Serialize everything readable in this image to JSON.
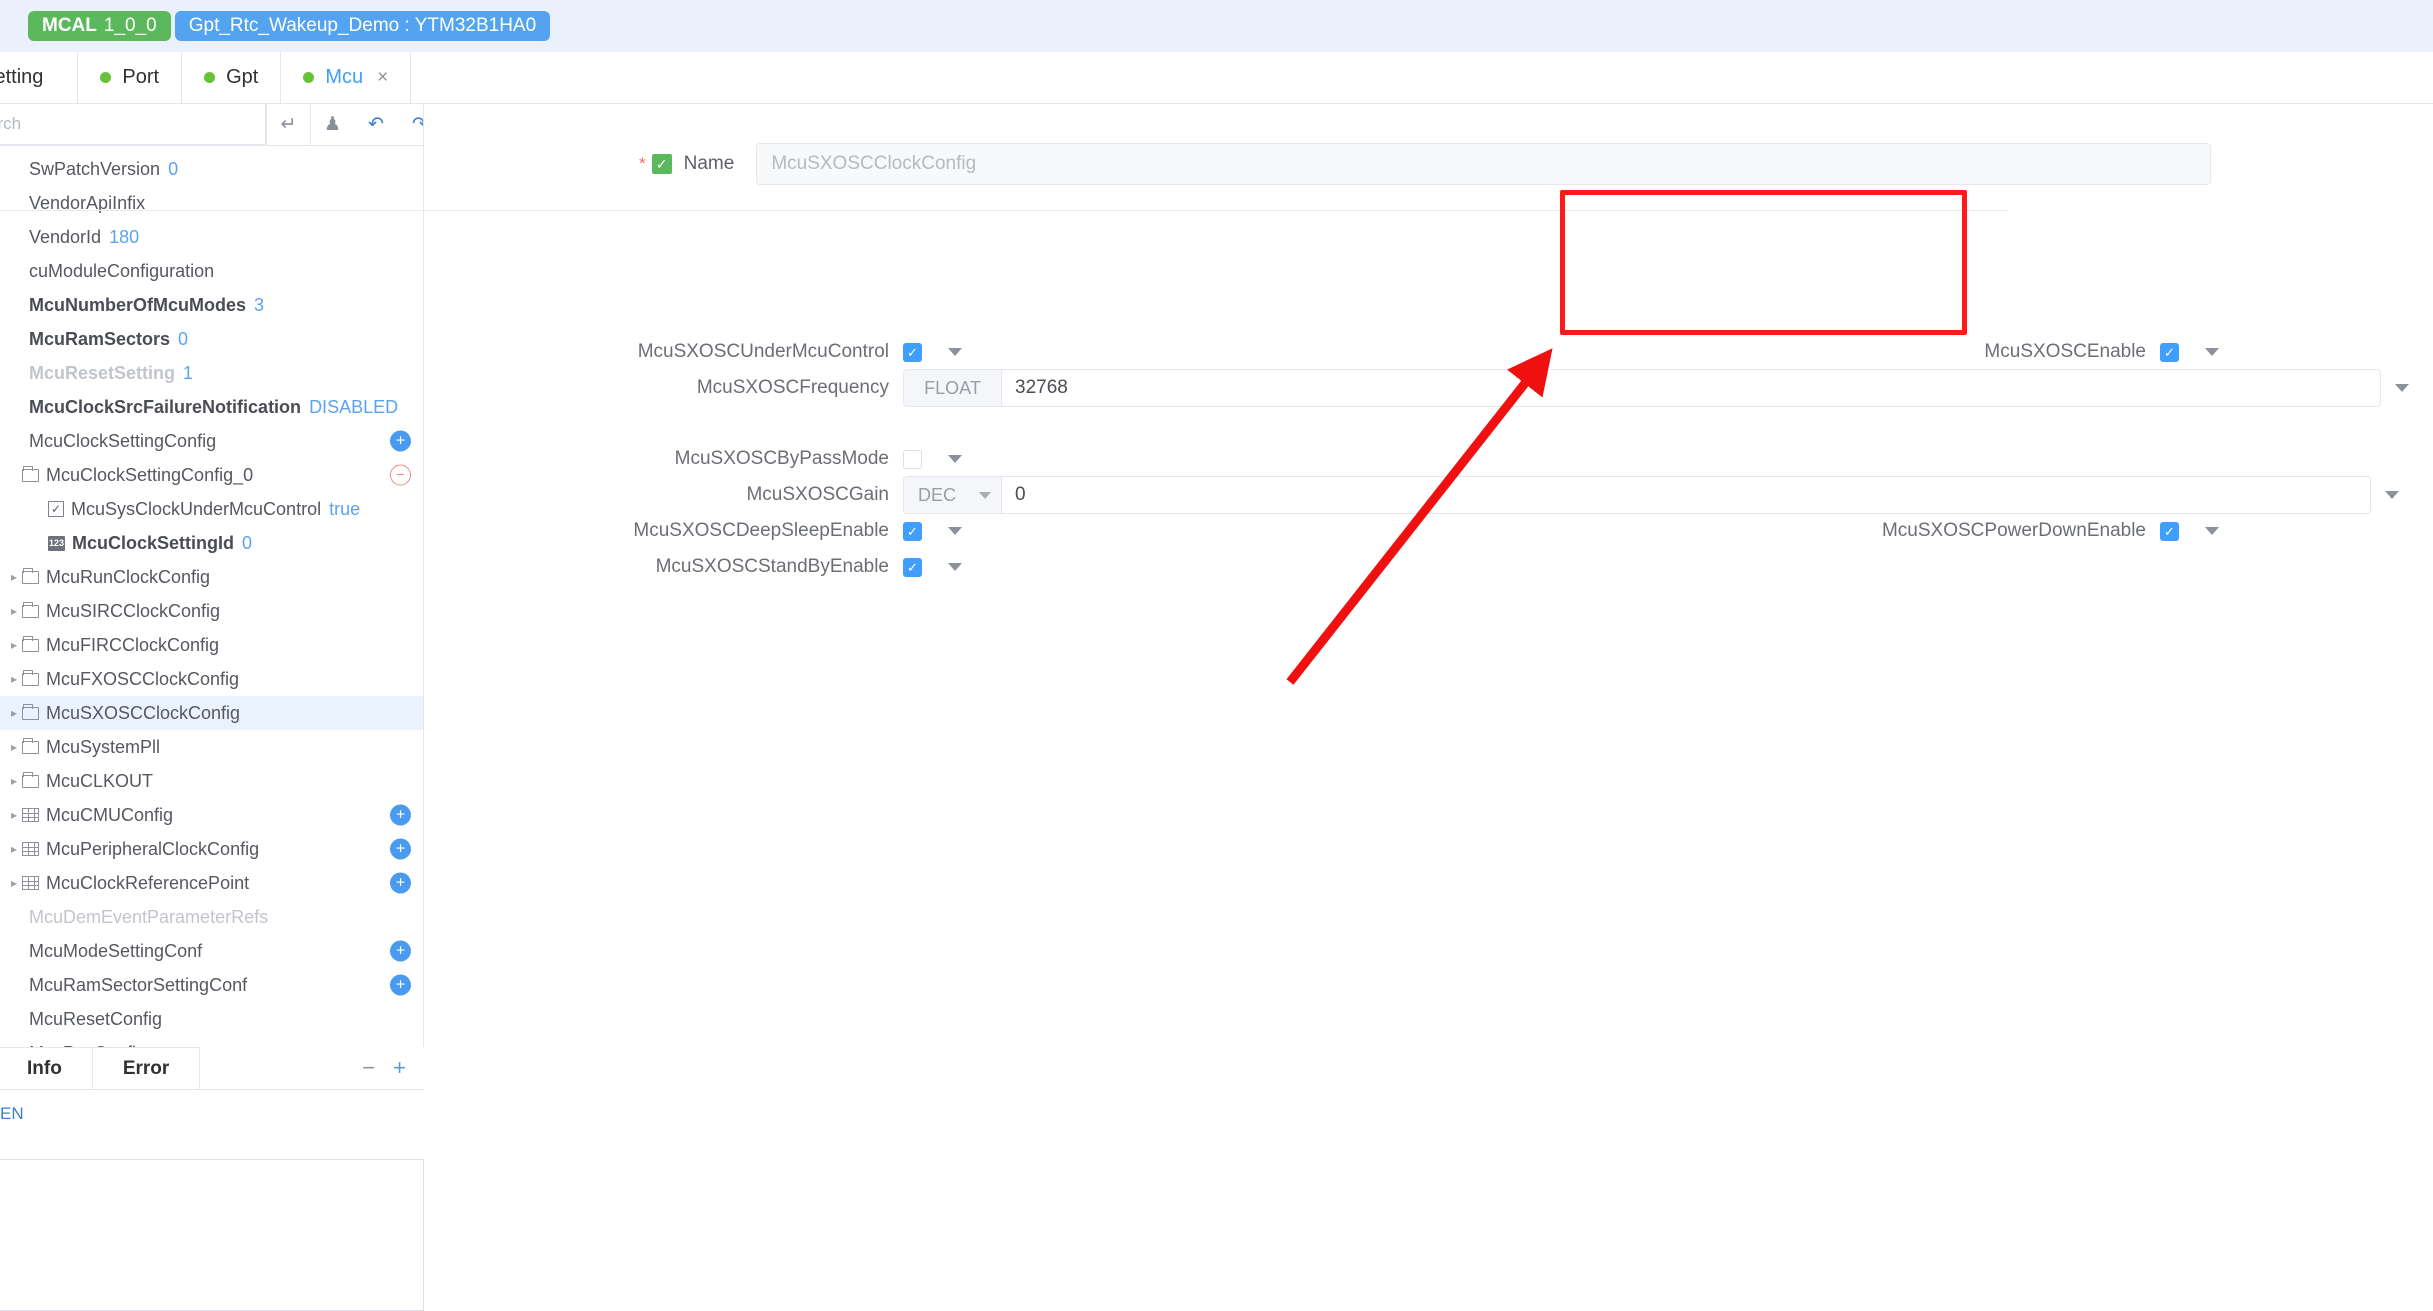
{
  "topbar": {
    "mcal_badge": {
      "name": "MCAL",
      "version": "1_0_0"
    },
    "project_badge": "Gpt_Rtc_Wakeup_Demo : YTM32B1HA0"
  },
  "tabs": [
    {
      "label": "t Setting",
      "dot": false,
      "active": false,
      "closable": false
    },
    {
      "label": "Port",
      "dot": true,
      "active": false,
      "closable": false
    },
    {
      "label": "Gpt",
      "dot": true,
      "active": false,
      "closable": false
    },
    {
      "label": "Mcu",
      "dot": true,
      "active": true,
      "closable": true,
      "close_glyph": "×"
    }
  ],
  "sidebar": {
    "search_placeholder": "arch",
    "toolbar_icons": [
      "undo-arrow-icon",
      "robot-icon",
      "undo-icon",
      "redo-icon"
    ],
    "tree": [
      {
        "label": "SwPatchVersion",
        "value": "0",
        "icon": "none",
        "indent": 0,
        "arrow": false,
        "bold": false,
        "muted": false
      },
      {
        "label": "VendorApiInfix",
        "value": "",
        "icon": "none",
        "indent": 0,
        "arrow": false,
        "bold": false,
        "muted": false
      },
      {
        "label": "VendorId",
        "value": "180",
        "icon": "none",
        "indent": 0,
        "arrow": false,
        "bold": false,
        "muted": false
      },
      {
        "label": "cuModuleConfiguration",
        "value": "",
        "icon": "none",
        "indent": 0,
        "arrow": false,
        "bold": false,
        "muted": false
      },
      {
        "label": "McuNumberOfMcuModes",
        "value": "3",
        "icon": "none",
        "indent": 0,
        "arrow": false,
        "bold": true,
        "muted": false
      },
      {
        "label": "McuRamSectors",
        "value": "0",
        "icon": "none",
        "indent": 0,
        "arrow": false,
        "bold": true,
        "muted": false
      },
      {
        "label": "McuResetSetting",
        "value": "1",
        "icon": "none",
        "indent": 0,
        "arrow": false,
        "bold": true,
        "muted": true
      },
      {
        "label": "McuClockSrcFailureNotification",
        "value": "DISABLED",
        "icon": "none",
        "indent": 0,
        "arrow": false,
        "bold": true,
        "muted": false
      },
      {
        "label": "McuClockSettingConfig",
        "value": "",
        "icon": "none",
        "indent": 0,
        "arrow": false,
        "bold": false,
        "muted": false,
        "action": "plus"
      },
      {
        "label": "McuClockSettingConfig_0",
        "value": "",
        "icon": "folder",
        "indent": 0,
        "arrow": false,
        "bold": false,
        "muted": false,
        "action": "minus"
      },
      {
        "label": "McuSysClockUnderMcuControl",
        "value": "true",
        "icon": "checkbox",
        "indent": 1,
        "arrow": false,
        "bold": false,
        "muted": false
      },
      {
        "label": "McuClockSettingId",
        "value": "0",
        "icon": "num",
        "indent": 1,
        "arrow": false,
        "bold": true,
        "muted": false
      },
      {
        "label": "McuRunClockConfig",
        "value": "",
        "icon": "folder",
        "indent": 0,
        "arrow": true,
        "bold": false,
        "muted": false
      },
      {
        "label": "McuSIRCClockConfig",
        "value": "",
        "icon": "folder",
        "indent": 0,
        "arrow": true,
        "bold": false,
        "muted": false
      },
      {
        "label": "McuFIRCClockConfig",
        "value": "",
        "icon": "folder",
        "indent": 0,
        "arrow": true,
        "bold": false,
        "muted": false
      },
      {
        "label": "McuFXOSCClockConfig",
        "value": "",
        "icon": "folder",
        "indent": 0,
        "arrow": true,
        "bold": false,
        "muted": false
      },
      {
        "label": "McuSXOSCClockConfig",
        "value": "",
        "icon": "folder",
        "indent": 0,
        "arrow": true,
        "bold": false,
        "muted": false,
        "selected": true
      },
      {
        "label": "McuSystemPll",
        "value": "",
        "icon": "folder",
        "indent": 0,
        "arrow": true,
        "bold": false,
        "muted": false
      },
      {
        "label": "McuCLKOUT",
        "value": "",
        "icon": "folder",
        "indent": 0,
        "arrow": true,
        "bold": false,
        "muted": false
      },
      {
        "label": "McuCMUConfig",
        "value": "",
        "icon": "grid",
        "indent": 0,
        "arrow": true,
        "bold": false,
        "muted": false,
        "action": "plus"
      },
      {
        "label": "McuPeripheralClockConfig",
        "value": "",
        "icon": "grid",
        "indent": 0,
        "arrow": true,
        "bold": false,
        "muted": false,
        "action": "plus"
      },
      {
        "label": "McuClockReferencePoint",
        "value": "",
        "icon": "grid",
        "indent": 0,
        "arrow": true,
        "bold": false,
        "muted": false,
        "action": "plus"
      },
      {
        "label": "McuDemEventParameterRefs",
        "value": "",
        "icon": "none",
        "indent": 0,
        "arrow": false,
        "bold": false,
        "muted": true
      },
      {
        "label": "McuModeSettingConf",
        "value": "",
        "icon": "none",
        "indent": 0,
        "arrow": false,
        "bold": false,
        "muted": false,
        "action": "plus"
      },
      {
        "label": "McuRamSectorSettingConf",
        "value": "",
        "icon": "none",
        "indent": 0,
        "arrow": false,
        "bold": false,
        "muted": false,
        "action": "plus"
      },
      {
        "label": "McuResetConfig",
        "value": "",
        "icon": "none",
        "indent": 0,
        "arrow": false,
        "bold": false,
        "muted": false
      },
      {
        "label": "McuPcuConfig",
        "value": "",
        "icon": "none",
        "indent": 0,
        "arrow": false,
        "bold": false,
        "muted": false
      }
    ]
  },
  "bottom_panel": {
    "tabs": [
      {
        "label": "Info",
        "active": true
      },
      {
        "label": "Error",
        "active": false
      }
    ],
    "collapse_glyph": "−",
    "expand_glyph": "+",
    "language": "EN"
  },
  "form": {
    "name_row": {
      "required_marker": "*",
      "label": "Name",
      "value": "McuSXOSCClockConfig"
    },
    "fields": [
      {
        "label": "McuSXOSCUnderMcuControl",
        "type": "checkbox",
        "checked": true,
        "column": "left",
        "row": 0
      },
      {
        "label": "McuSXOSCEnable",
        "type": "checkbox",
        "checked": true,
        "column": "right",
        "row": 0
      },
      {
        "label": "McuSXOSCFrequency",
        "type": "input",
        "prefix": "FLOAT",
        "prefix_kind": "static",
        "value": "32768",
        "column": "left",
        "row": 1
      },
      {
        "label": "McuSXOSCByPassMode",
        "type": "checkbox",
        "checked": false,
        "column": "left",
        "row": 2
      },
      {
        "label": "McuSXOSCGain",
        "type": "input",
        "prefix": "DEC",
        "prefix_kind": "select",
        "value": "0",
        "column": "left",
        "row": 3
      },
      {
        "label": "McuSXOSCDeepSleepEnable",
        "type": "checkbox",
        "checked": true,
        "column": "left",
        "row": 4
      },
      {
        "label": "McuSXOSCPowerDownEnable",
        "type": "checkbox",
        "checked": true,
        "column": "right",
        "row": 4
      },
      {
        "label": "McuSXOSCStandByEnable",
        "type": "checkbox",
        "checked": true,
        "column": "left",
        "row": 5
      }
    ]
  },
  "annotation": {
    "highlight_color": "#ff1a1a",
    "shapes": [
      "rectangle-highlight",
      "arrow-pointer"
    ]
  }
}
